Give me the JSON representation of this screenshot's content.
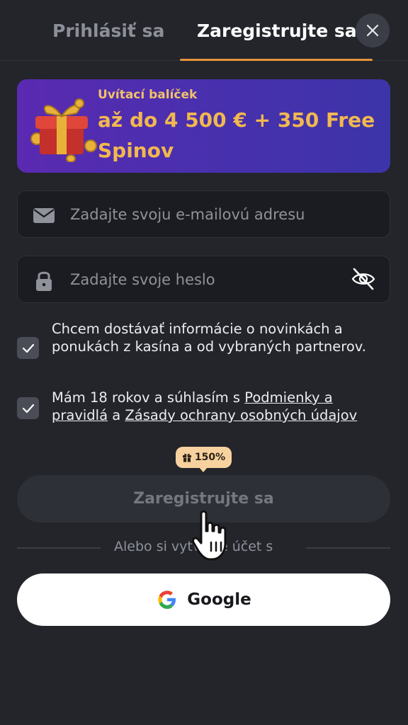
{
  "header": {
    "tab_login": "Prihlásiť sa",
    "tab_register": "Zaregistrujte sa",
    "close_icon": "close-icon"
  },
  "promo": {
    "subtitle": "Uvítací balíček",
    "title": "až do 4 500 € + 350 Free Spinov",
    "icon": "gift-box-icon"
  },
  "form": {
    "email_placeholder": "Zadajte svoju e-mailovú adresu",
    "email_value": "",
    "password_placeholder": "Zadajte svoje heslo",
    "password_value": "",
    "email_icon": "envelope-icon",
    "password_icon": "lock-icon",
    "toggle_icon": "eye-off-icon"
  },
  "consents": {
    "marketing_text": "Chcem dostávať informácie o novinkách a ponukách z kasína a od vybraných partnerov.",
    "marketing_checked": true,
    "age_prefix": "Mám 18 rokov a súhlasím s ",
    "terms_link": "Podmienky a pravidlá",
    "age_middle": " a ",
    "privacy_link": "Zásady ochrany osobných údajov",
    "age_checked": true
  },
  "bonus_badge": "150%",
  "register_button": "Zaregistrujte sa",
  "divider_text": "Alebo si vytvorte účet s",
  "google_button": "Google",
  "colors": {
    "background": "#23252b",
    "accent": "#e7953a",
    "promo_text": "#f2b84f",
    "promo_bg_start": "#5a2ab1",
    "promo_bg_end": "#3d34a9"
  }
}
